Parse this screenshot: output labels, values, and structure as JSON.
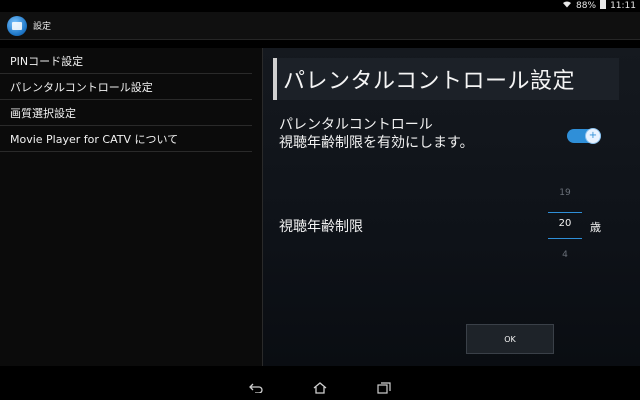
{
  "status": {
    "wifi_icon": "wifi-icon",
    "battery_percent": "88%",
    "battery_icon": "battery-icon",
    "time": "11:11"
  },
  "action_bar": {
    "app_icon": "settings-app-icon",
    "title": "設定"
  },
  "sidebar": {
    "items": [
      {
        "label": "PINコード設定"
      },
      {
        "label": "パレンタルコントロール設定"
      },
      {
        "label": "画質選択設定"
      },
      {
        "label": "Movie Player for CATV について"
      }
    ]
  },
  "main": {
    "title": "パレンタルコントロール設定",
    "toggle": {
      "label_line1": "パレンタルコントロール",
      "label_line2": "視聴年齢制限を有効にします。",
      "state": "on",
      "color": "#2f8fd8"
    },
    "age_limit": {
      "label": "視聴年齢制限",
      "previous_value": "19",
      "current_value": "20",
      "next_value": "4",
      "unit": "歳"
    },
    "ok_label": "OK"
  },
  "nav": {
    "back_icon": "back-icon",
    "home_icon": "home-icon",
    "recents_icon": "recents-icon"
  }
}
